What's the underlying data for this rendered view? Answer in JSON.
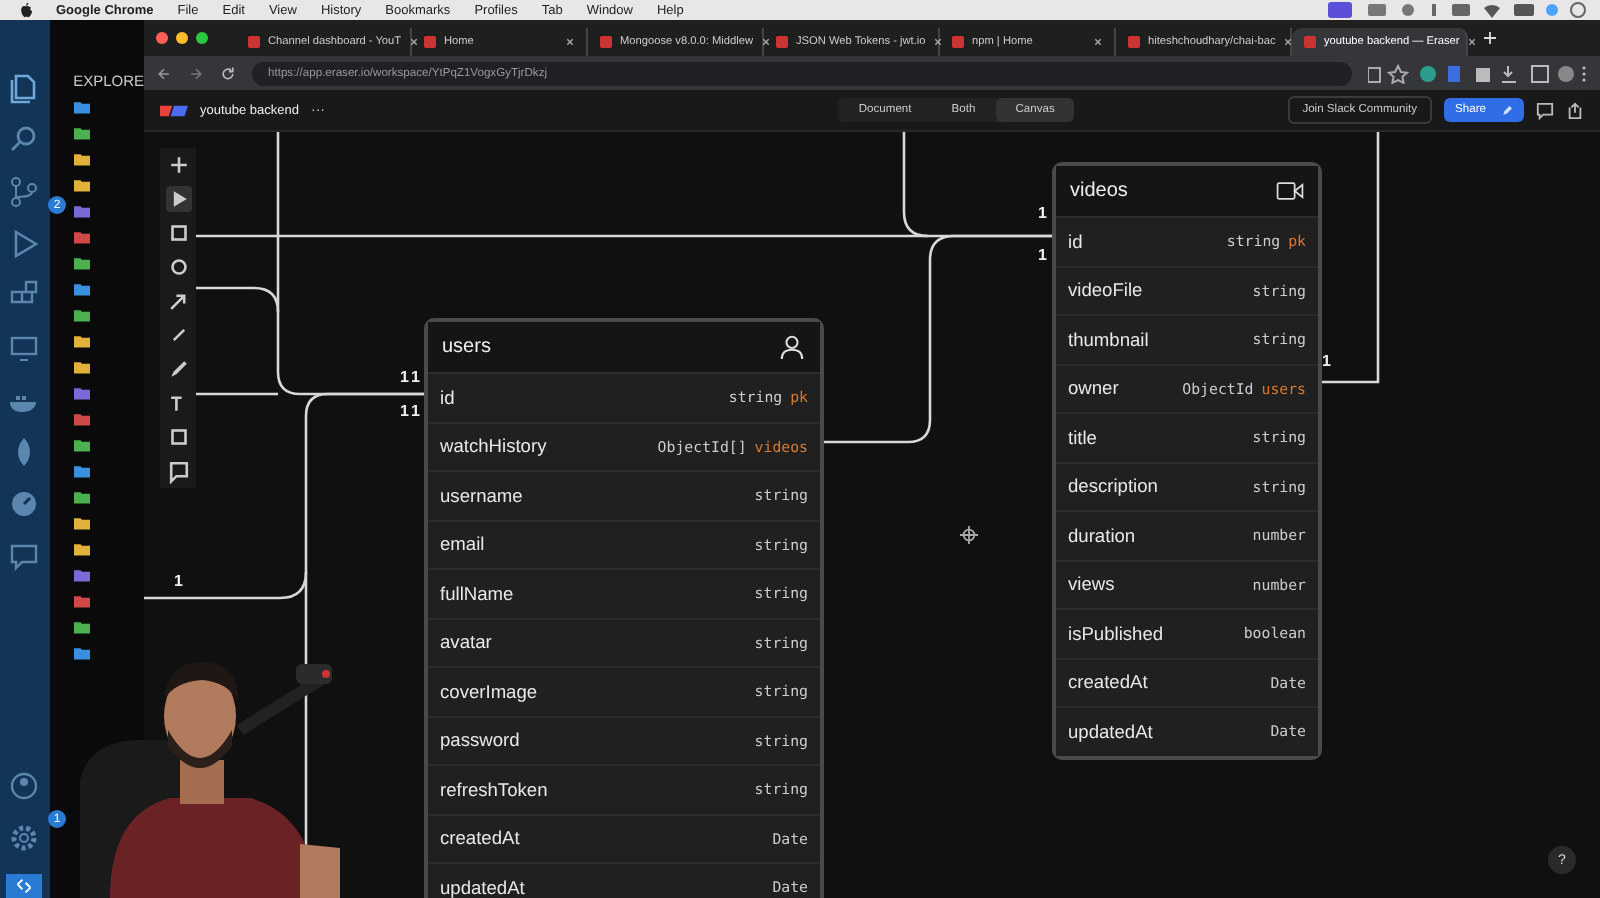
{
  "menu_bar": {
    "app": "Google Chrome",
    "items": [
      "File",
      "Edit",
      "View",
      "History",
      "Bookmarks",
      "Profiles",
      "Tab",
      "Window",
      "Help"
    ]
  },
  "editor": {
    "explorer_title": "EXPLORE",
    "notifications": [
      {
        "count": "2"
      },
      {
        "count": "1"
      }
    ]
  },
  "browser": {
    "tabs": [
      {
        "title": "Channel dashboard - YouT",
        "selected": false
      },
      {
        "title": "Home",
        "selected": false
      },
      {
        "title": "Mongoose v8.0.0: Middlew",
        "selected": false
      },
      {
        "title": "JSON Web Tokens - jwt.io",
        "selected": false
      },
      {
        "title": "npm | Home",
        "selected": false
      },
      {
        "title": "hiteshchoudhary/chai-bac",
        "selected": false
      },
      {
        "title": "youtube backend — Eraser",
        "selected": true
      }
    ],
    "url": "https://app.eraser.io/workspace/YtPqZ1VogxGyTjrDkzj"
  },
  "app_bar": {
    "file_name": "youtube backend",
    "more": "···",
    "views": [
      {
        "label": "Document",
        "selected": false
      },
      {
        "label": "Both",
        "selected": false
      },
      {
        "label": "Canvas",
        "selected": true
      }
    ],
    "community": "Join Slack Community",
    "share": "Share"
  },
  "canvas": {
    "cardinalities": [
      "1",
      "1",
      "1",
      "1",
      "1",
      "1",
      "1",
      "1"
    ],
    "help": "?",
    "tables": [
      {
        "name": "users",
        "kind": "user",
        "rows": [
          {
            "field": "id",
            "type": "string",
            "ref": "pk"
          },
          {
            "field": "watchHistory",
            "type": "ObjectId[]",
            "ref": "videos"
          },
          {
            "field": "username",
            "type": "string"
          },
          {
            "field": "email",
            "type": "string"
          },
          {
            "field": "fullName",
            "type": "string"
          },
          {
            "field": "avatar",
            "type": "string"
          },
          {
            "field": "coverImage",
            "type": "string"
          },
          {
            "field": "password",
            "type": "string"
          },
          {
            "field": "refreshToken",
            "type": "string"
          },
          {
            "field": "createdAt",
            "type": "Date"
          },
          {
            "field": "updatedAt",
            "type": "Date"
          }
        ]
      },
      {
        "name": "videos",
        "kind": "video",
        "rows": [
          {
            "field": "id",
            "type": "string",
            "ref": "pk"
          },
          {
            "field": "videoFile",
            "type": "string"
          },
          {
            "field": "thumbnail",
            "type": "string"
          },
          {
            "field": "owner",
            "type": "ObjectId",
            "ref": "users"
          },
          {
            "field": "title",
            "type": "string"
          },
          {
            "field": "description",
            "type": "string"
          },
          {
            "field": "duration",
            "type": "number"
          },
          {
            "field": "views",
            "type": "number"
          },
          {
            "field": "isPublished",
            "type": "boolean"
          },
          {
            "field": "createdAt",
            "type": "Date"
          },
          {
            "field": "updatedAt",
            "type": "Date"
          }
        ]
      }
    ]
  }
}
